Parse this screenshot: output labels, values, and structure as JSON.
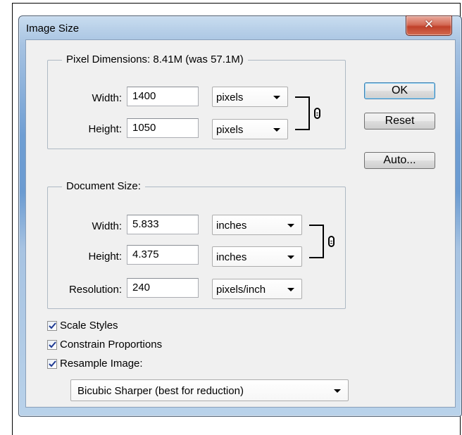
{
  "dialog": {
    "title": "Image Size",
    "close_glyph": "✕"
  },
  "pixel_dimensions": {
    "legend": "Pixel Dimensions:  8.41M (was 57.1M)",
    "width_label": "Width:",
    "width_value": "1400",
    "width_unit": "pixels",
    "height_label": "Height:",
    "height_value": "1050",
    "height_unit": "pixels"
  },
  "document_size": {
    "legend": "Document Size:",
    "width_label": "Width:",
    "width_value": "5.833",
    "width_unit": "inches",
    "height_label": "Height:",
    "height_value": "4.375",
    "height_unit": "inches",
    "resolution_label": "Resolution:",
    "resolution_value": "240",
    "resolution_unit": "pixels/inch"
  },
  "buttons": {
    "ok": "OK",
    "reset": "Reset",
    "auto": "Auto..."
  },
  "options": {
    "scale_styles": {
      "label": "Scale Styles",
      "checked": true
    },
    "constrain_proportions": {
      "label": "Constrain Proportions",
      "checked": true
    },
    "resample_image": {
      "label": "Resample Image:",
      "checked": true
    }
  },
  "resample_method": "Bicubic Sharper (best for reduction)",
  "icons": {
    "link": "chain-link-icon",
    "dropdown": "chevron-down-icon",
    "check": "checkmark-icon"
  },
  "colors": {
    "titlebar": "#b7cfe8",
    "close_button": "#c0412a",
    "client_bg": "#f0f0f0",
    "default_button_border": "#3c7fb1"
  }
}
